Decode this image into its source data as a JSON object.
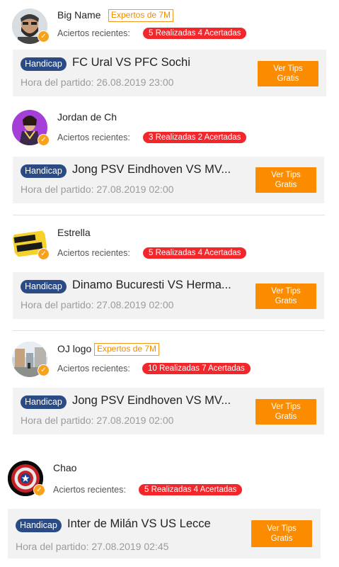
{
  "tips": [
    {
      "name": "Big  Name",
      "expert_badge": "Expertos de 7M",
      "aciertos_label": "Aciertos recientes:",
      "stats": "5 Realizadas 4 Acertadas",
      "handicap": "Handicap",
      "match": "FC Ural  VS  PFC Sochi",
      "kickoff": "Hora del partido: 26.08.2019 23:00",
      "btn_line1": "Ver Tips",
      "btn_line2": "Gratis"
    },
    {
      "name": "Jordan de Ch",
      "aciertos_label": "Aciertos recientes:",
      "stats": "3 Realizadas 2 Acertadas",
      "handicap": "Handicap",
      "match": "Jong PSV Eindhoven  VS  MV...",
      "kickoff": "Hora del partido: 27.08.2019 02:00",
      "btn_line1": "Ver Tips",
      "btn_line2": "Gratis"
    },
    {
      "name": "Estrella",
      "aciertos_label": "Aciertos recientes:",
      "stats": "5 Realizadas 4 Acertadas",
      "handicap": "Handicap",
      "match": "Dinamo Bucuresti  VS  Herma...",
      "kickoff": "Hora del partido: 27.08.2019 02:00",
      "btn_line1": "Ver Tips",
      "btn_line2": "Gratis"
    },
    {
      "name": "OJ logo",
      "expert_badge": "Expertos de 7M",
      "aciertos_label": "Aciertos recientes:",
      "stats": "10 Realizadas 7 Acertadas",
      "handicap": "Handicap",
      "match": "Jong PSV Eindhoven  VS  MV...",
      "kickoff": "Hora del partido: 27.08.2019 02:00",
      "btn_line1": "Ver Tips",
      "btn_line2": "Gratis"
    },
    {
      "name": "Chao",
      "aciertos_label": "Aciertos recientes:",
      "stats": "5 Realizadas 4 Acertadas",
      "handicap": "Handicap",
      "match": "Inter de Milán  VS  US Lecce",
      "kickoff": "Hora del partido: 27.08.2019 02:45",
      "btn_line1": "Ver Tips",
      "btn_line2": "Gratis"
    }
  ],
  "icons": {
    "avatar_0": "bearded-man-avatar",
    "avatar_1": "purple-character-avatar",
    "avatar_2": "omar-momani-logo-avatar",
    "avatar_3": "street-photo-avatar",
    "avatar_4": "captain-america-shield-avatar",
    "verified": "verified-check-icon"
  },
  "colors": {
    "accent_orange": "#fb8c00",
    "stats_red": "#f2272c",
    "handicap_blue": "#2b4b86",
    "card_bg": "#f2f2f2"
  }
}
